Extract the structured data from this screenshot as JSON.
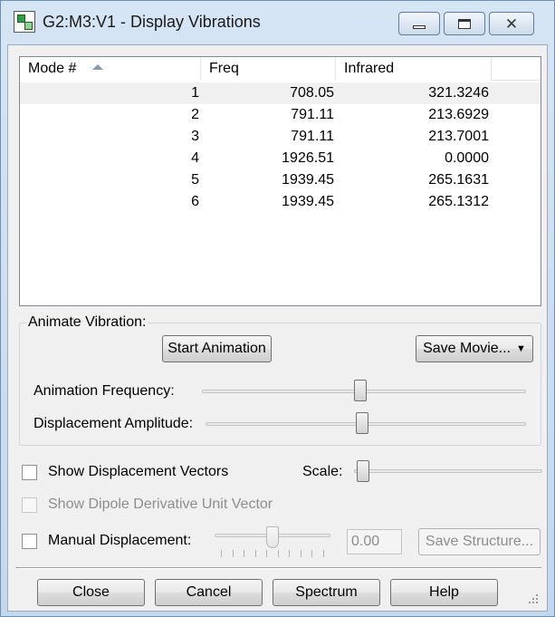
{
  "window": {
    "title": "G2:M3:V1 - Display Vibrations",
    "icon": "gaussview-app-icon",
    "controls": {
      "minimize_icon": "minimize-icon",
      "maximize_icon": "maximize-icon",
      "close_glyph": "✕"
    }
  },
  "table": {
    "headers": {
      "mode": "Mode #",
      "freq": "Freq",
      "infrared": "Infrared"
    },
    "sorted_column": "mode",
    "rows": [
      {
        "mode": "1",
        "freq": "708.05",
        "infrared": "321.3246"
      },
      {
        "mode": "2",
        "freq": "791.11",
        "infrared": "213.6929"
      },
      {
        "mode": "3",
        "freq": "791.11",
        "infrared": "213.7001"
      },
      {
        "mode": "4",
        "freq": "1926.51",
        "infrared": "0.0000"
      },
      {
        "mode": "5",
        "freq": "1939.45",
        "infrared": "265.1631"
      },
      {
        "mode": "6",
        "freq": "1939.45",
        "infrared": "265.1312"
      }
    ],
    "selected_row": 0
  },
  "animate": {
    "group_label": "Animate Vibration:",
    "start_button": "Start Animation",
    "save_movie_button": "Save Movie...",
    "frequency_label": "Animation Frequency:",
    "amplitude_label": "Displacement Amplitude:",
    "frequency_level": 0.49,
    "amplitude_level": 0.49
  },
  "options": {
    "show_vectors_label": "Show Displacement Vectors",
    "show_vectors_checked": false,
    "scale_label": "Scale:",
    "scale_level": 0.05,
    "show_dipole_label": "Show Dipole Derivative Unit Vector",
    "show_dipole_enabled": false,
    "manual_label": "Manual Displacement:",
    "manual_checked": false,
    "manual_level": 0.5,
    "manual_value": "0.00",
    "save_structure_button": "Save Structure..."
  },
  "buttons": {
    "close": "Close",
    "cancel": "Cancel",
    "spectrum": "Spectrum",
    "help": "Help"
  }
}
